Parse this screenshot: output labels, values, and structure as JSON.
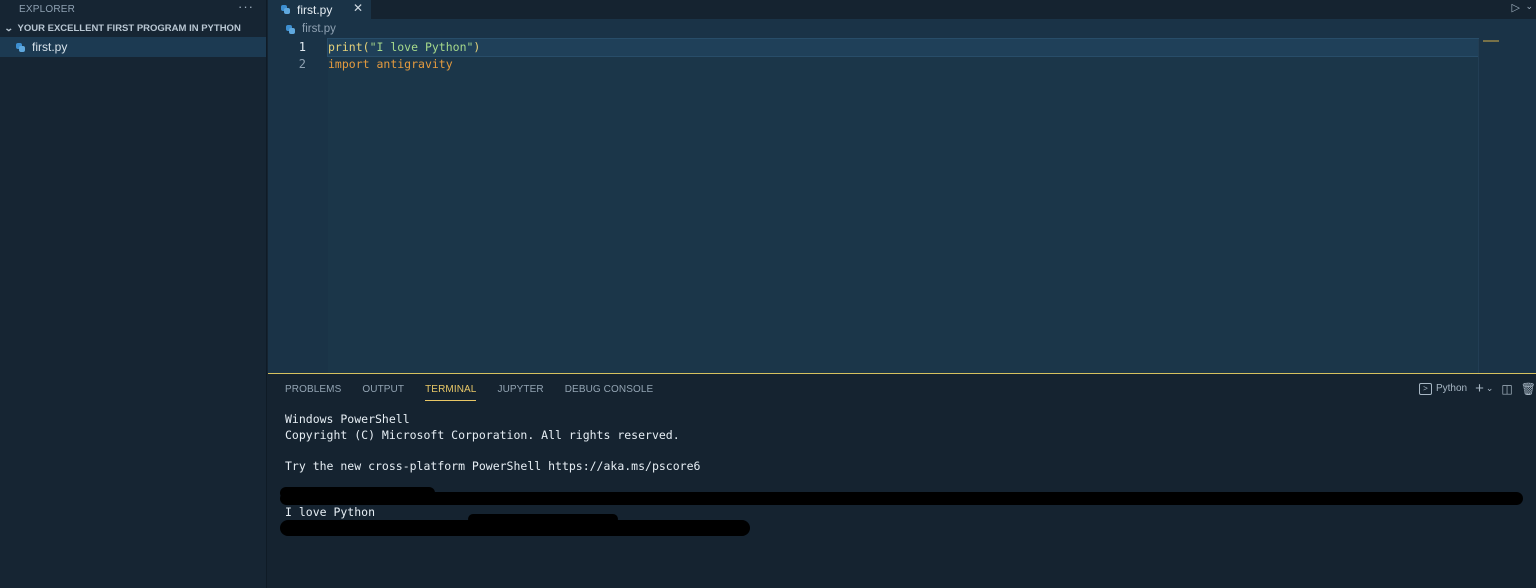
{
  "sidebar": {
    "header": "EXPLORER",
    "more": "···",
    "folder": "YOUR EXCELLENT FIRST PROGRAM IN PYTHON",
    "files": [
      "first.py"
    ]
  },
  "editor": {
    "tab": {
      "label": "first.py",
      "close": "✕"
    },
    "breadcrumb": "first.py",
    "line_numbers": [
      "1",
      "2"
    ],
    "code": {
      "line1": {
        "fn": "print",
        "open": "(",
        "str": "\"I love Python\"",
        "close": ")"
      },
      "line2": {
        "kw": "import",
        "mod": "antigravity"
      }
    }
  },
  "panel": {
    "tabs": [
      "PROBLEMS",
      "OUTPUT",
      "TERMINAL",
      "JUPYTER",
      "DEBUG CONSOLE"
    ],
    "active_tab": "TERMINAL",
    "shell": "Python",
    "terminal": {
      "lines": [
        "Windows PowerShell",
        "Copyright (C) Microsoft Corporation. All rights reserved.",
        "",
        "Try the new cross-platform PowerShell https://aka.ms/pscore6",
        "",
        "",
        "I love Python"
      ]
    }
  },
  "colors": {
    "accent": "#e8c766",
    "editor_bg": "#1b3649",
    "sidebar_bg": "#162533"
  }
}
